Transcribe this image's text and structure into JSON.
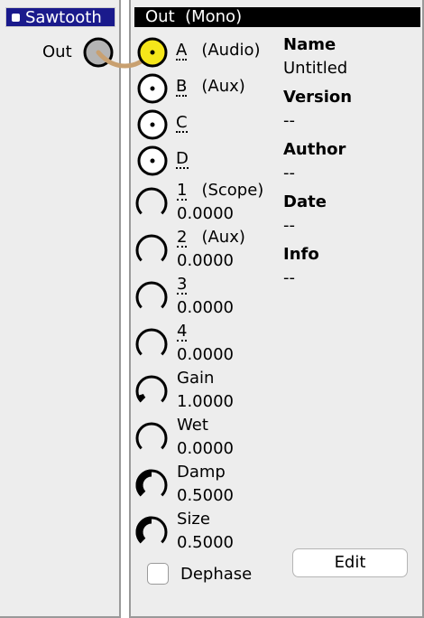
{
  "source_module": {
    "title": "Sawtooth",
    "output_label": "Out"
  },
  "out_module": {
    "title": "Out  (Mono)",
    "inputs": [
      {
        "name": "A",
        "type": "(Audio)",
        "connected": true
      },
      {
        "name": "B",
        "type": "(Aux)",
        "connected": false
      },
      {
        "name": "C",
        "type": "",
        "connected": false
      },
      {
        "name": "D",
        "type": "",
        "connected": false
      }
    ],
    "knobs": [
      {
        "name": "1",
        "type": "(Scope)",
        "value": "0.0000",
        "level": 0.0
      },
      {
        "name": "2",
        "type": "(Aux)",
        "value": "0.0000",
        "level": 0.0
      },
      {
        "name": "3",
        "type": "",
        "value": "0.0000",
        "level": 0.0
      },
      {
        "name": "4",
        "type": "",
        "value": "0.0000",
        "level": 0.0
      },
      {
        "name": "Gain",
        "type": "",
        "value": "1.0000",
        "level": 0.1
      },
      {
        "name": "Wet",
        "type": "",
        "value": "0.0000",
        "level": 0.0
      },
      {
        "name": "Damp",
        "type": "",
        "value": "0.5000",
        "level": 0.5
      },
      {
        "name": "Size",
        "type": "",
        "value": "0.5000",
        "level": 0.5
      }
    ],
    "info": [
      {
        "label": "Name",
        "value": "Untitled"
      },
      {
        "label": "Version",
        "value": "--"
      },
      {
        "label": "Author",
        "value": "--"
      },
      {
        "label": "Date",
        "value": "--"
      },
      {
        "label": "Info",
        "value": "--"
      }
    ],
    "dephase_label": "Dephase",
    "dephase_checked": false,
    "edit_label": "Edit"
  },
  "colors": {
    "title_bar_source": "#1a1a8c",
    "title_bar_out": "#000000",
    "connected_port": "#f5e61a",
    "output_port": "#b4b4b4",
    "patch_cable": "#c8a070",
    "panel": "#ededed"
  },
  "icons": {
    "port": "circle-port-icon",
    "knob": "knob-arc-icon",
    "title_square": "module-square-icon"
  }
}
